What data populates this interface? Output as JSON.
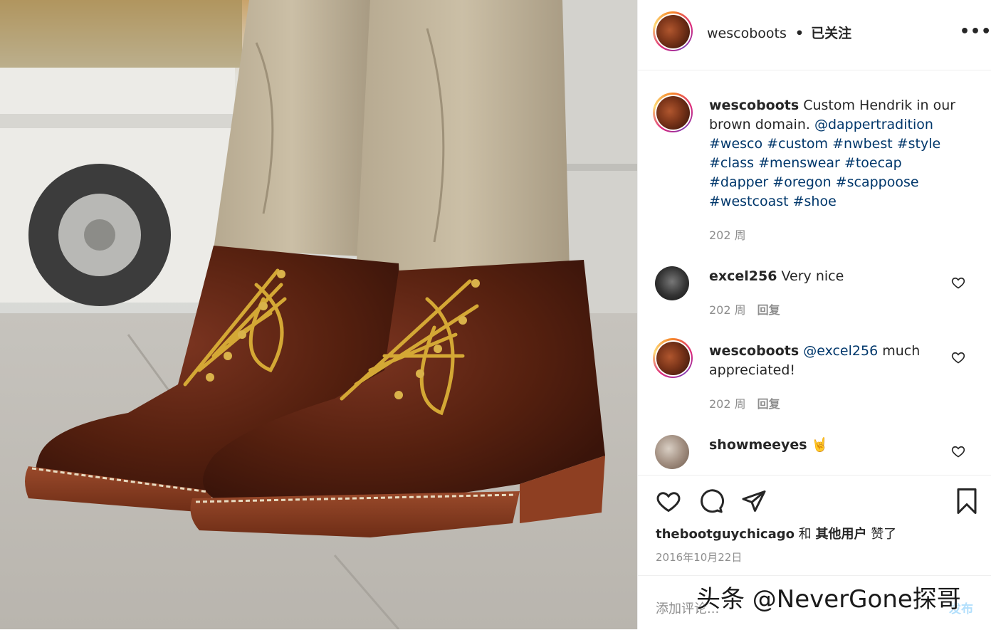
{
  "post": {
    "username": "wescoboots",
    "separator": "•",
    "follow_status": "已关注",
    "more_label": "•••"
  },
  "caption": {
    "username": "wescoboots",
    "text": "Custom Hendrik in our brown domain.",
    "mention": "@dappertradition",
    "hashtags": "#wesco #custom #nwbest #style #class #menswear #toecap #dapper #oregon #scappoose #westcoast #shoe",
    "time": "202 周"
  },
  "comments": [
    {
      "username": "excel256",
      "text": "Very nice",
      "time": "202 周",
      "reply": "回复"
    },
    {
      "username": "wescoboots",
      "mention": "@excel256",
      "text": "much appreciated!",
      "time": "202 周",
      "reply": "回复"
    },
    {
      "username": "showmeeyes",
      "emoji": "🤘"
    }
  ],
  "likes": {
    "user": "thebootguychicago",
    "and": "和",
    "others": "其他用户",
    "liked": "赞了"
  },
  "date": "2016年10月22日",
  "add_comment": {
    "placeholder": "添加评论...",
    "post_label": "发布"
  },
  "watermark": "头条 @NeverGone探哥",
  "icons": {
    "like": "heart-icon",
    "comment": "comment-bubble-icon",
    "share": "paper-plane-icon",
    "save": "bookmark-icon"
  },
  "colors": {
    "link": "#00376b",
    "muted": "#8e8e8e",
    "post_disabled": "#b2dffc"
  }
}
